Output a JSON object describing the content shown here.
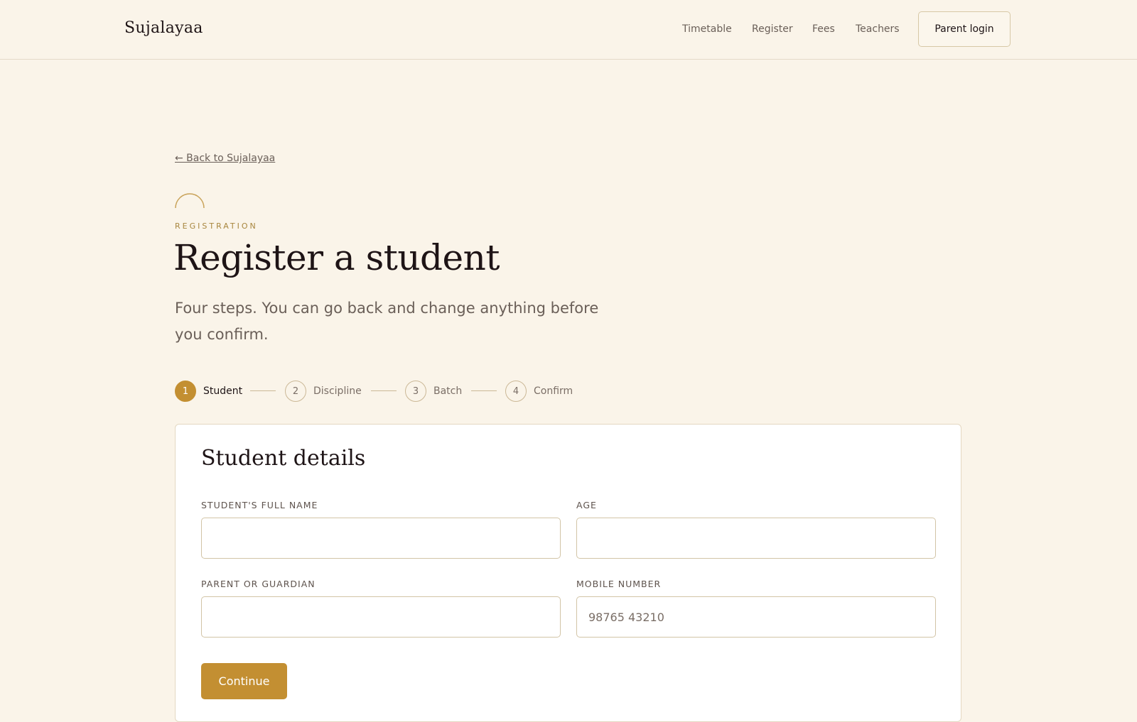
{
  "header": {
    "brand": "Sujalayaa",
    "nav": [
      "Timetable",
      "Register",
      "Fees",
      "Teachers"
    ],
    "login_label": "Parent login"
  },
  "back_link": "← Back to Sujalayaa",
  "eyebrow": "REGISTRATION",
  "title": "Register a student",
  "subtitle": "Four steps. You can go back and change anything before you confirm.",
  "steps": [
    {
      "number": "1",
      "label": "Student"
    },
    {
      "number": "2",
      "label": "Discipline"
    },
    {
      "number": "3",
      "label": "Batch"
    },
    {
      "number": "4",
      "label": "Confirm"
    }
  ],
  "form": {
    "title": "Student details",
    "fields": {
      "full_name": {
        "label": "STUDENT'S FULL NAME",
        "value": "",
        "placeholder": ""
      },
      "age": {
        "label": "AGE",
        "value": "",
        "placeholder": ""
      },
      "guardian": {
        "label": "PARENT OR GUARDIAN",
        "value": "",
        "placeholder": ""
      },
      "mobile": {
        "label": "MOBILE NUMBER",
        "value": "",
        "placeholder": "98765 43210"
      }
    },
    "continue_label": "Continue"
  },
  "colors": {
    "background": "#faf4e9",
    "accent": "#c38f32",
    "text": "#1e1416",
    "muted": "#6a5f58"
  }
}
